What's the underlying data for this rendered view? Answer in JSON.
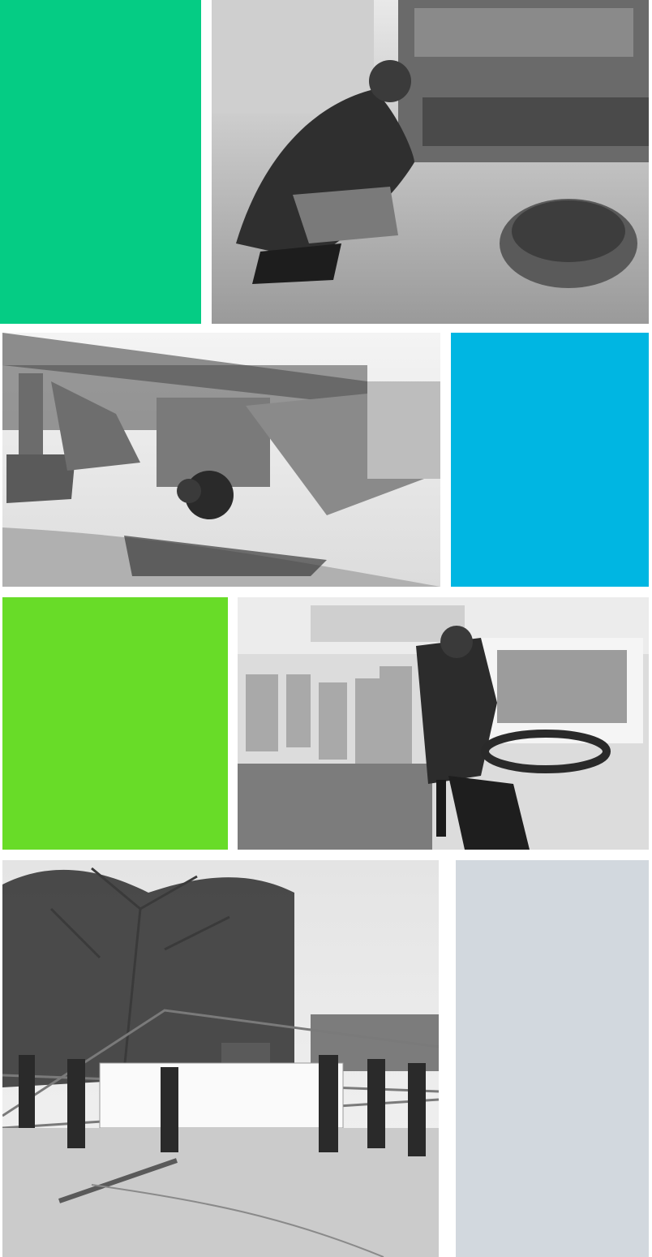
{
  "colors": {
    "tile_green": "#05cc84",
    "tile_blue": "#00b6e2",
    "tile_lime": "#68dc28",
    "tile_gray": "#d2d8de",
    "photo_tone": "grayscale"
  },
  "rows": [
    {
      "photo": {
        "icon": "mechanic-inspecting-truck-photo"
      },
      "tile_color": "tile_green"
    },
    {
      "photo": {
        "icon": "wheel-loader-and-excavator-photo"
      },
      "tile_color": "tile_blue"
    },
    {
      "photo": {
        "icon": "bus-driver-photo"
      },
      "tile_color": "tile_lime"
    },
    {
      "photo": {
        "icon": "people-assembling-tent-photo"
      },
      "tile_color": "tile_gray"
    }
  ]
}
